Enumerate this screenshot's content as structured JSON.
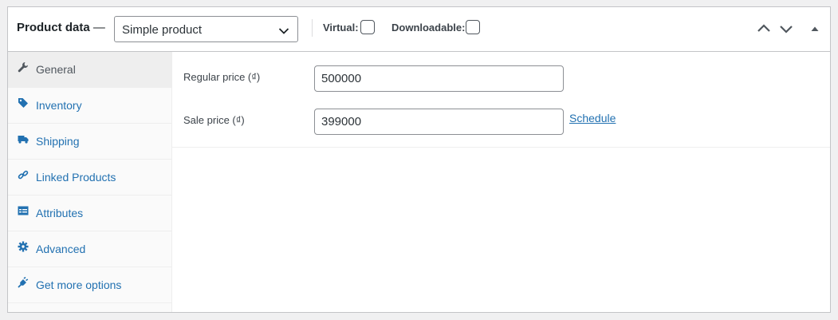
{
  "header": {
    "title": "Product data",
    "title_dash": "—",
    "product_type_selected": "Simple product",
    "virtual_label": "Virtual:",
    "downloadable_label": "Downloadable:"
  },
  "icons": {
    "move_up": "chevron-up-icon",
    "move_down": "chevron-down-icon",
    "toggle": "triangle-up-icon"
  },
  "sidebar": {
    "tabs": [
      {
        "label": "General",
        "icon": "wrench-icon",
        "active": true
      },
      {
        "label": "Inventory",
        "icon": "tag-icon",
        "active": false
      },
      {
        "label": "Shipping",
        "icon": "truck-icon",
        "active": false
      },
      {
        "label": "Linked Products",
        "icon": "link-icon",
        "active": false
      },
      {
        "label": "Attributes",
        "icon": "table-icon",
        "active": false
      },
      {
        "label": "Advanced",
        "icon": "gear-icon",
        "active": false
      },
      {
        "label": "Get more options",
        "icon": "plug-icon",
        "active": false
      }
    ]
  },
  "general": {
    "regular_price_label": "Regular price (₫)",
    "regular_price_value": "500000",
    "sale_price_label": "Sale price (₫)",
    "sale_price_value": "399000",
    "schedule_link": "Schedule"
  },
  "colors": {
    "link": "#2271b1",
    "text": "#1d2327",
    "border": "#c3c4c7",
    "sidebar_bg": "#fafafa",
    "active_tab_bg": "#eeeeee"
  }
}
